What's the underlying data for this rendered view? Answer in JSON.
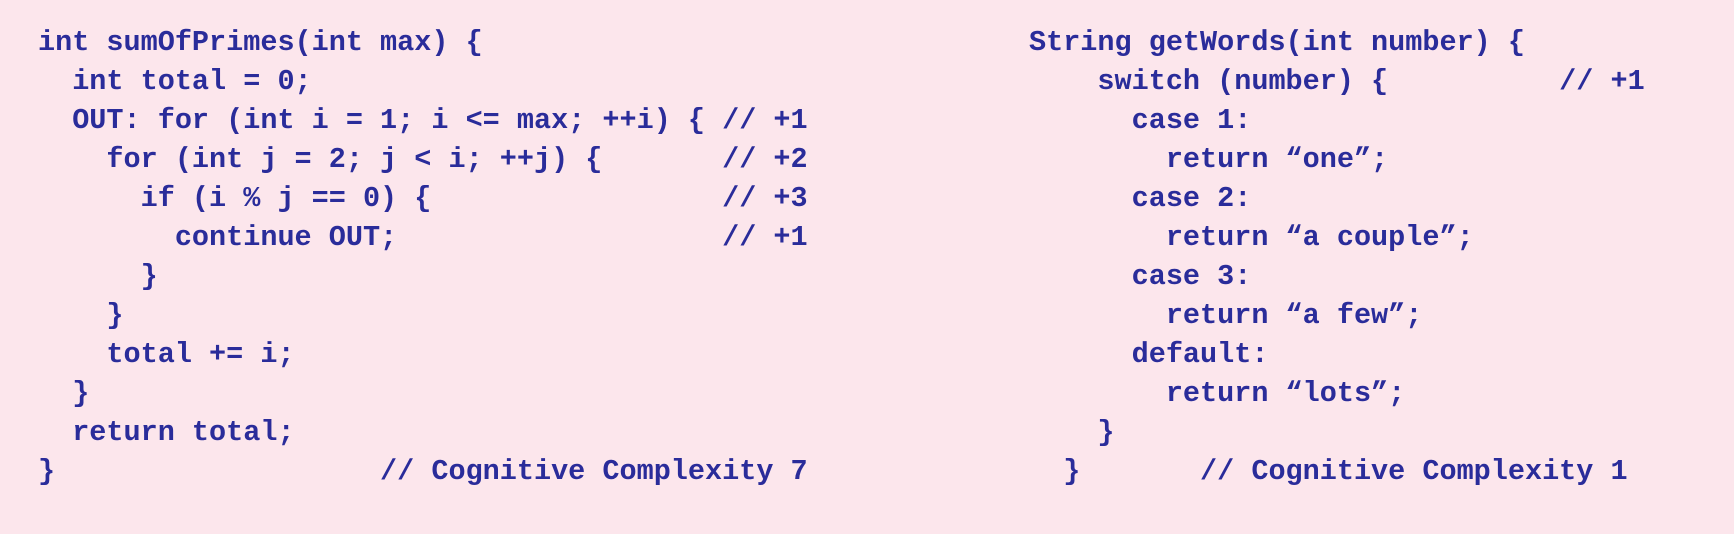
{
  "left_snippet": {
    "lines": [
      "int sumOfPrimes(int max) {",
      "  int total = 0;",
      "  OUT: for (int i = 1; i <= max; ++i) { // +1",
      "    for (int j = 2; j < i; ++j) {       // +2",
      "      if (i % j == 0) {                 // +3",
      "        continue OUT;                   // +1",
      "      }",
      "    }",
      "    total += i;",
      "  }",
      "  return total;",
      "}                   // Cognitive Complexity 7"
    ]
  },
  "right_snippet": {
    "lines": [
      "String getWords(int number) {",
      "    switch (number) {          // +1",
      "      case 1:",
      "        return “one”;",
      "      case 2:",
      "        return “a couple”;",
      "      case 3:",
      "        return “a few”;",
      "      default:",
      "        return “lots”;",
      "    }",
      "  }       // Cognitive Complexity 1"
    ]
  },
  "colors": {
    "background": "#fce6ec",
    "code_text": "#2a2c9a"
  }
}
